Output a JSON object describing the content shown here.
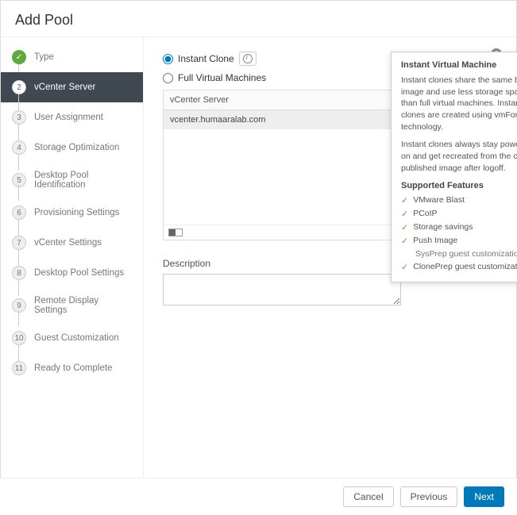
{
  "header": {
    "title": "Add Pool"
  },
  "steps": [
    {
      "num": "",
      "label": "Type",
      "state": "done"
    },
    {
      "num": "2",
      "label": "vCenter Server",
      "state": "current"
    },
    {
      "num": "3",
      "label": "User Assignment",
      "state": ""
    },
    {
      "num": "4",
      "label": "Storage Optimization",
      "state": ""
    },
    {
      "num": "5",
      "label": "Desktop Pool Identification",
      "state": ""
    },
    {
      "num": "6",
      "label": "Provisioning Settings",
      "state": ""
    },
    {
      "num": "7",
      "label": "vCenter Settings",
      "state": ""
    },
    {
      "num": "8",
      "label": "Desktop Pool Settings",
      "state": ""
    },
    {
      "num": "9",
      "label": "Remote Display Settings",
      "state": ""
    },
    {
      "num": "10",
      "label": "Guest Customization",
      "state": ""
    },
    {
      "num": "11",
      "label": "Ready to Complete",
      "state": ""
    }
  ],
  "options": {
    "instant_clone": "Instant Clone",
    "full_vm": "Full Virtual Machines"
  },
  "table": {
    "header": "vCenter Server",
    "row": "vcenter.humaaralab.com"
  },
  "description": {
    "label": "Description",
    "value": ""
  },
  "popover": {
    "title": "Instant Virtual Machine",
    "p1": "Instant clones share the same base image and use less storage space than full virtual machines. Instant clones are created using vmFork technology.",
    "p2": "Instant clones always stay powered on and get recreated from the current published image after logoff.",
    "supported_label": "Supported Features",
    "features": {
      "f1": "VMware Blast",
      "f2": "PCoIP",
      "f3": "Storage savings",
      "f4": "Push Image",
      "f5": "SysPrep guest customization",
      "f6": "ClonePrep guest customization"
    }
  },
  "footer": {
    "cancel": "Cancel",
    "previous": "Previous",
    "next": "Next"
  }
}
